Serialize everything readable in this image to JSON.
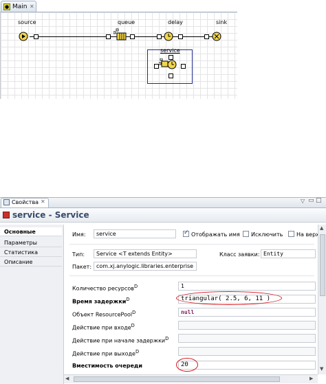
{
  "editor": {
    "tab_label": "Main",
    "blocks": {
      "source": "source",
      "queue": "queue",
      "delay": "delay",
      "sink": "sink",
      "service": "service"
    }
  },
  "properties": {
    "tab_label": "Свойства",
    "title": "service - Service",
    "nav": [
      "Основные",
      "Параметры",
      "Статистика",
      "Описание"
    ],
    "name_label": "Имя:",
    "name_value": "service",
    "show_name_label": "Отображать имя",
    "exclude_label": "Исключить",
    "on_top_label": "На верх",
    "type_label": "Тип:",
    "type_value": "Service <T extends Entity>",
    "class_label": "Класс заявки:",
    "class_value": "Entity",
    "package_label": "Пакет:",
    "package_value": "com.xj.anylogic.libraries.enterprise",
    "rows": [
      {
        "label": "Количество ресурсов",
        "value": "1",
        "bold": false
      },
      {
        "label": "Время задержки",
        "value": "triangular( 2.5, 6, 11 )",
        "bold": true
      },
      {
        "label": "Объект ResourcePool",
        "value": "null",
        "bold": false
      },
      {
        "label": "Действие при входе",
        "value": "",
        "bold": false
      },
      {
        "label": "Действие при начале задержки",
        "value": "",
        "bold": false
      },
      {
        "label": "Действие при выходе",
        "value": "",
        "bold": false
      },
      {
        "label": "Вместимость очереди",
        "value": "20",
        "bold": true
      }
    ],
    "superscript": "D"
  },
  "colors": {
    "highlight": "#d8141c",
    "title": "#384a6b"
  }
}
